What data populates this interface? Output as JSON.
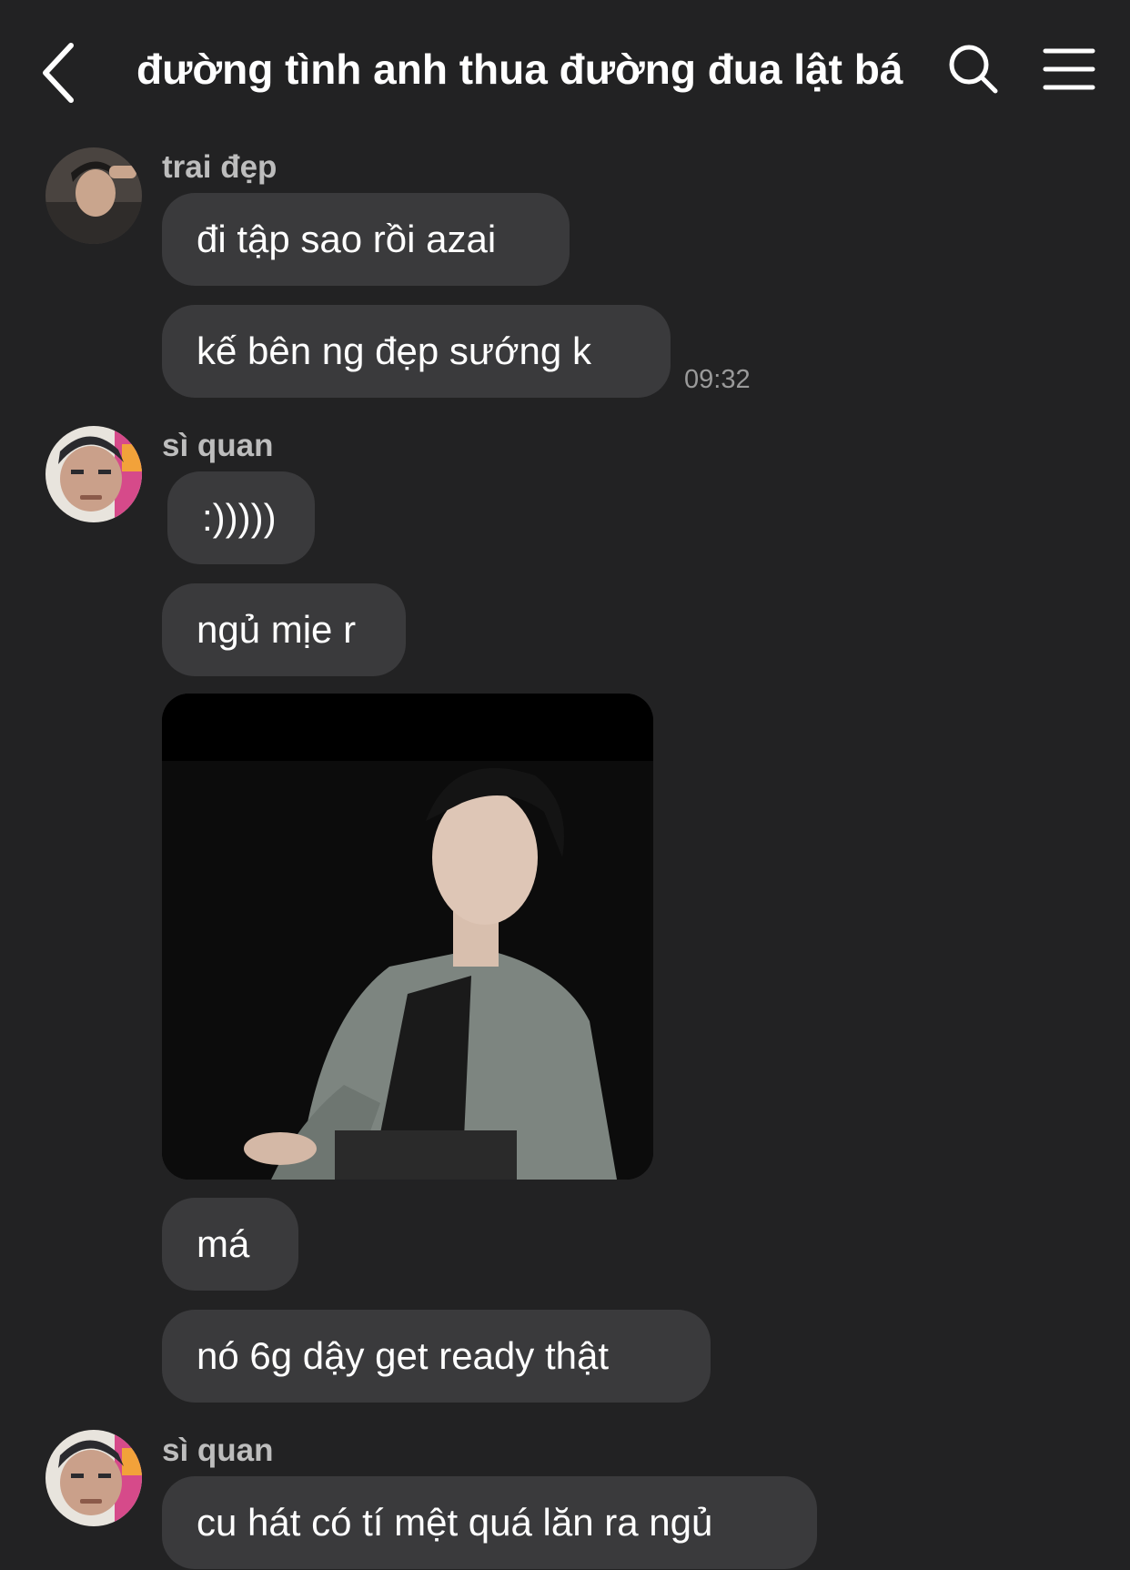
{
  "header": {
    "title": "đường tình anh thua đường đua lật bá",
    "back_icon": "chevron-left-icon",
    "search_icon": "search-icon",
    "menu_icon": "menu-icon"
  },
  "messages": [
    {
      "sender": "trai đẹp",
      "text": "đi tập sao rồi azai"
    },
    {
      "text": "kế bên ng đẹp sướng k",
      "time": "09:32"
    },
    {
      "sender": "sì quan",
      "text": ":)))))"
    },
    {
      "text": "ngủ mịe r"
    },
    {
      "image": "photo of sleeping man in denim jacket"
    },
    {
      "text": "má"
    },
    {
      "text": "nó 6g dậy get ready thật"
    },
    {
      "sender": "sì quan",
      "text": "cu hát có tí mệt quá lăn ra ngủ"
    }
  ],
  "colors": {
    "background": "#222223",
    "bubble": "#3a3a3c",
    "text": "#ffffff",
    "muted": "#9a9a9a"
  }
}
